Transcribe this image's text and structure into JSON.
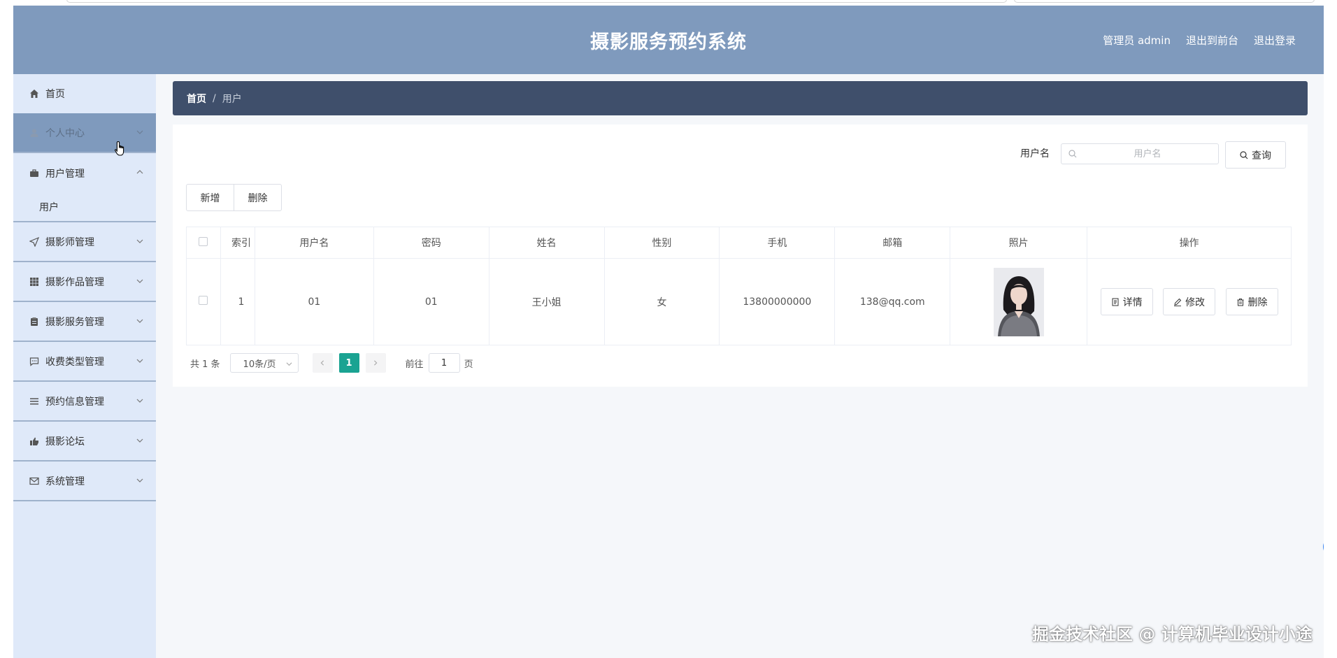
{
  "app": {
    "title": "摄影服务预约系统",
    "user_label": "管理员 admin",
    "front_link": "退出到前台",
    "logout": "退出登录"
  },
  "sidebar": {
    "items": [
      {
        "label": "首页",
        "icon": "home-icon"
      },
      {
        "label": "个人中心",
        "icon": "user-icon",
        "active": true
      },
      {
        "label": "用户管理",
        "icon": "briefcase-icon",
        "expanded": true
      },
      {
        "label": "摄影师管理",
        "icon": "send-icon"
      },
      {
        "label": "摄影作品管理",
        "icon": "grid-icon"
      },
      {
        "label": "摄影服务管理",
        "icon": "clipboard-icon"
      },
      {
        "label": "收费类型管理",
        "icon": "message-icon"
      },
      {
        "label": "预约信息管理",
        "icon": "list-icon"
      },
      {
        "label": "摄影论坛",
        "icon": "thumb-icon"
      },
      {
        "label": "系统管理",
        "icon": "mail-icon"
      }
    ],
    "submenu": {
      "label": "用户"
    }
  },
  "breadcrumb": {
    "home": "首页",
    "current": "用户"
  },
  "search": {
    "label": "用户名",
    "placeholder": "用户名",
    "button": "查询"
  },
  "toolbar": {
    "add": "新增",
    "delete": "删除"
  },
  "table": {
    "headers": [
      "索引",
      "用户名",
      "密码",
      "姓名",
      "性别",
      "手机",
      "邮箱",
      "照片",
      "操作"
    ],
    "rows": [
      {
        "index": "1",
        "username": "01",
        "password": "01",
        "name": "王小姐",
        "gender": "女",
        "phone": "13800000000",
        "email": "138@qq.com"
      }
    ],
    "actions": {
      "detail": "详情",
      "edit": "修改",
      "delete": "删除"
    }
  },
  "pagination": {
    "total": "共 1 条",
    "page_size": "10条/页",
    "current": "1",
    "goto_label": "前往",
    "goto_value": "1",
    "page_suffix": "页"
  },
  "watermark": "掘金技术社区 @ 计算机毕业设计小途",
  "colors": {
    "header": "#7f9abd",
    "sidebar": "#dfe9f9",
    "breadcrumb": "#3f4f6b",
    "active_page": "#1aa392",
    "collapse_button": "#3d86f0"
  }
}
